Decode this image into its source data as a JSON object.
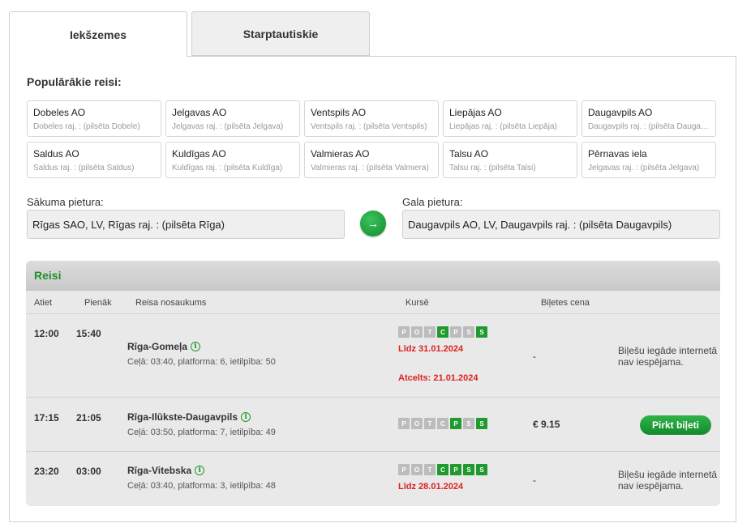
{
  "tabs": {
    "domestic": "Iekšzemes",
    "international": "Starptautiskie"
  },
  "popular": {
    "title": "Populārākie reisi:",
    "items": [
      {
        "name": "Dobeles AO",
        "sub": "Dobeles raj. : (pilsēta Dobele)"
      },
      {
        "name": "Jelgavas AO",
        "sub": "Jelgavas raj. : (pilsēta Jelgava)"
      },
      {
        "name": "Ventspils AO",
        "sub": "Ventspils raj. : (pilsēta Ventspils)"
      },
      {
        "name": "Liepājas AO",
        "sub": "Liepājas raj. : (pilsēta Liepāja)"
      },
      {
        "name": "Daugavpils AO",
        "sub": "Daugavpils raj. : (pilsēta Daugavpils)"
      },
      {
        "name": "Saldus AO",
        "sub": "Saldus raj. : (pilsēta Saldus)"
      },
      {
        "name": "Kuldīgas AO",
        "sub": "Kuldīgas raj. : (pilsēta Kuldīga)"
      },
      {
        "name": "Valmieras AO",
        "sub": "Valmieras raj. : (pilsēta Valmiera)"
      },
      {
        "name": "Talsu AO",
        "sub": "Talsu raj. : (pilsēta Talsi)"
      },
      {
        "name": "Pērnavas iela",
        "sub": "Jelgavas raj. : (pilsēta Jelgava)"
      }
    ]
  },
  "route": {
    "from_label": "Sākuma pietura:",
    "from_value": "Rīgas SAO, LV, Rīgas raj. : (pilsēta Rīga)",
    "to_label": "Gala pietura:",
    "to_value": "Daugavpils AO, LV, Daugavpils raj. : (pilsēta Daugavpils)",
    "swap_icon": "→"
  },
  "trips": {
    "title": "Reisi",
    "columns": {
      "departs": "Atiet",
      "arrives": "Pienāk",
      "name": "Reisa nosaukums",
      "runs": "Kursē",
      "price": "Biļetes cena"
    },
    "day_letters": [
      "P",
      "O",
      "T",
      "C",
      "P",
      "S",
      "S"
    ],
    "rows": [
      {
        "departs": "12:00",
        "arrives": "15:40",
        "name": "Rīga-Gomeļa",
        "info": "Ceļā: 03:40, platforma: 6, ietilpība: 50",
        "days_active": [
          false,
          false,
          false,
          true,
          false,
          false,
          true
        ],
        "note1": "Līdz 31.01.2024",
        "note2": "Atcelts: 21.01.2024",
        "price": "-",
        "status": "Biļešu iegāde internetā nav iespējama."
      },
      {
        "departs": "17:15",
        "arrives": "21:05",
        "name": "Rīga-Ilūkste-Daugavpils",
        "info": "Ceļā: 03:50, platforma: 7, ietilpība: 49",
        "days_active": [
          false,
          false,
          false,
          false,
          true,
          false,
          true
        ],
        "price": "€ 9.15",
        "buy": "Pirkt biļeti"
      },
      {
        "departs": "23:20",
        "arrives": "03:00",
        "name": "Rīga-Vitebska",
        "info": "Ceļā: 03:40, platforma: 3, ietilpība: 48",
        "days_active": [
          false,
          false,
          false,
          true,
          true,
          true,
          true
        ],
        "note1": "Līdz 28.01.2024",
        "price": "-",
        "status": "Biļešu iegāde internetā nav iespējama."
      }
    ]
  },
  "colors": {
    "accent": "#1f9a2e",
    "alert": "#e02020",
    "day_off": "#bcbcbc"
  },
  "icons": {
    "info": "info-icon",
    "swap": "arrow-right-icon"
  }
}
